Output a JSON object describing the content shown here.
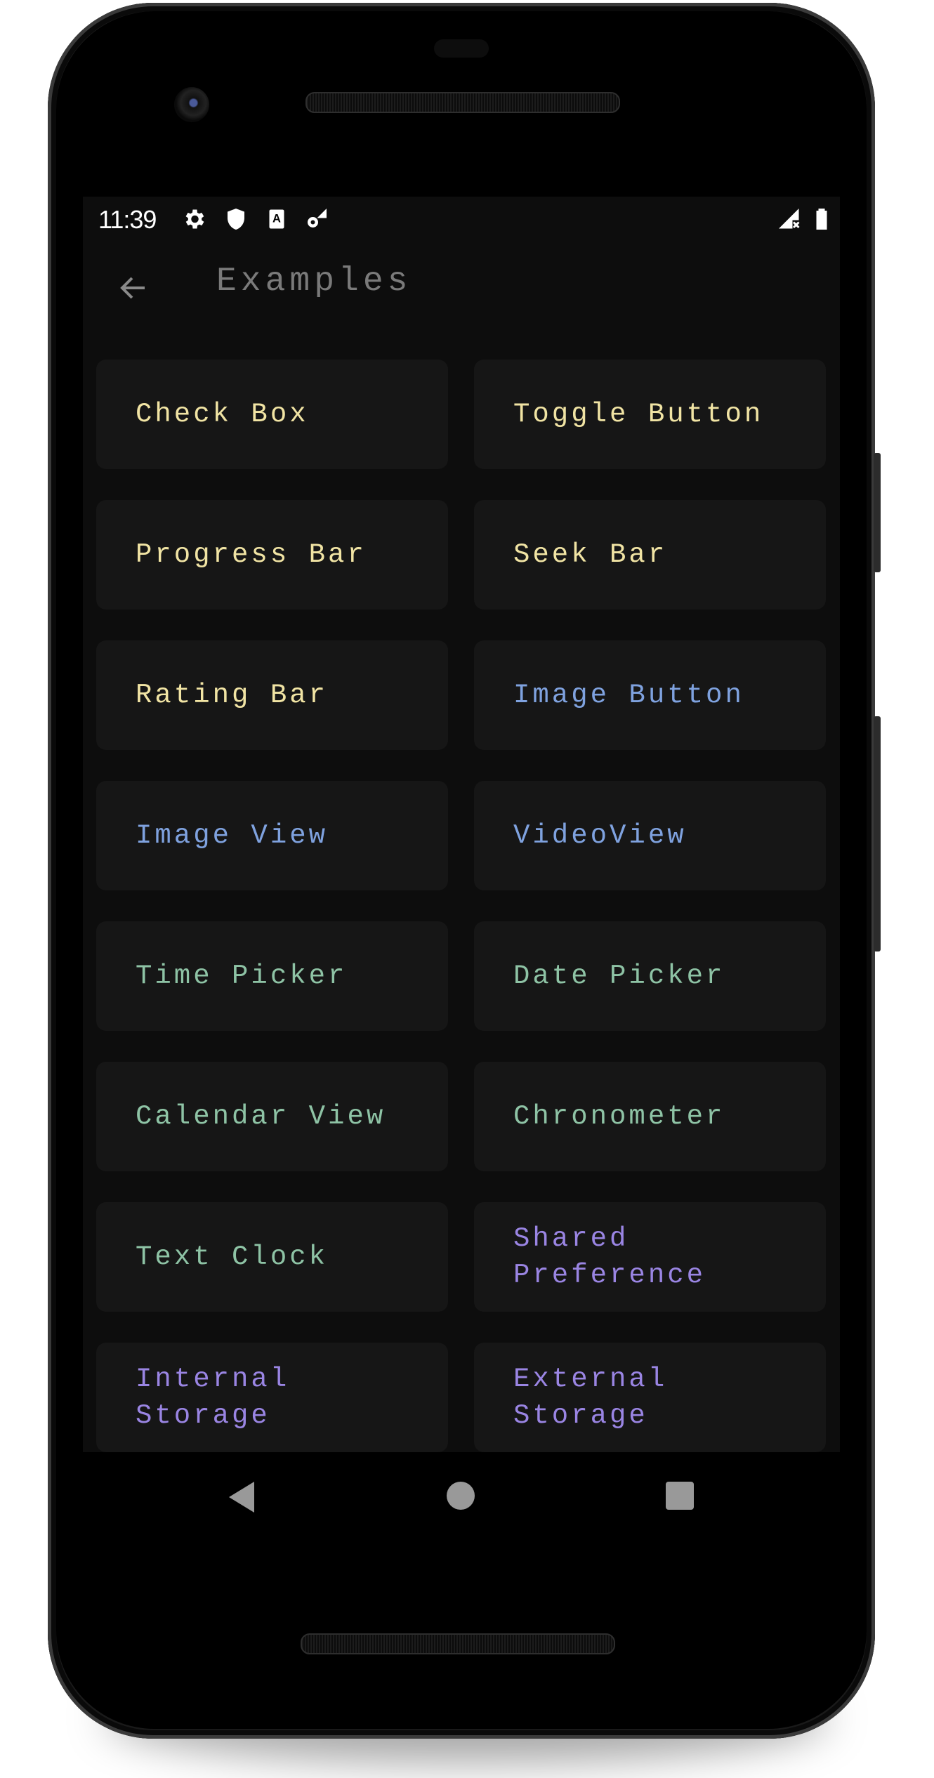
{
  "status_bar": {
    "time": "11:39",
    "left_icons": [
      "settings-icon",
      "shield-icon",
      "font-a-icon",
      "settings-cellular-icon"
    ],
    "right_icons": [
      "signal-no-data-icon",
      "battery-full-icon"
    ]
  },
  "app_bar": {
    "title": "Examples",
    "back_icon": "arrow-back-icon"
  },
  "colors": {
    "yellow": "#f1e4a4",
    "blue": "#7fa2df",
    "green": "#8ec3a5",
    "purple": "#9a85e3",
    "card_bg": "#161616",
    "screen_bg": "#0d0d0d"
  },
  "examples": [
    {
      "label": "Check Box",
      "color": "#f1e4a4"
    },
    {
      "label": "Toggle Button",
      "color": "#f1e4a4"
    },
    {
      "label": "Progress Bar",
      "color": "#f1e4a4"
    },
    {
      "label": "Seek Bar",
      "color": "#f1e4a4"
    },
    {
      "label": "Rating Bar",
      "color": "#f1e4a4"
    },
    {
      "label": "Image Button",
      "color": "#7fa2df"
    },
    {
      "label": "Image View",
      "color": "#7fa2df"
    },
    {
      "label": "VideoView",
      "color": "#7fa2df"
    },
    {
      "label": "Time Picker",
      "color": "#8ec3a5"
    },
    {
      "label": "Date Picker",
      "color": "#8ec3a5"
    },
    {
      "label": "Calendar View",
      "color": "#8ec3a5"
    },
    {
      "label": "Chronometer",
      "color": "#8ec3a5"
    },
    {
      "label": "Text Clock",
      "color": "#8ec3a5"
    },
    {
      "label": "Shared Preference",
      "color": "#9a85e3"
    },
    {
      "label": "Internal Storage",
      "color": "#9a85e3"
    },
    {
      "label": "External Storage",
      "color": "#9a85e3"
    }
  ],
  "nav_bar": {
    "icons": [
      "nav-back-icon",
      "nav-home-icon",
      "nav-recents-icon"
    ]
  }
}
